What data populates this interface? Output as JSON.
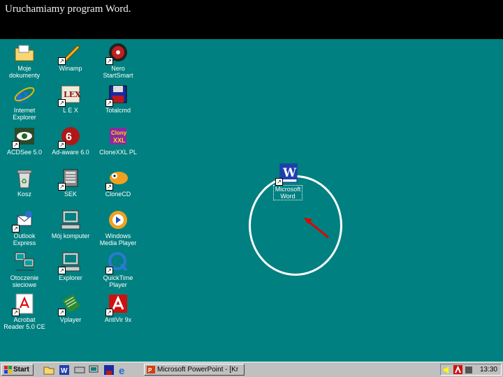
{
  "caption": "Uruchamiamy program Word.",
  "desktop_icons": [
    {
      "label": "Moje\ndokumenty",
      "icon": "folder-icon"
    },
    {
      "label": "Winamp",
      "icon": "winamp-icon"
    },
    {
      "label": "Nero\nStartSmart",
      "icon": "nero-icon"
    },
    {
      "label": "Internet\nExplorer",
      "icon": "internet-explorer-icon"
    },
    {
      "label": "L E X",
      "icon": "lex-icon"
    },
    {
      "label": "Totalcmd",
      "icon": "total-commander-icon"
    },
    {
      "label": "ACDSee 5.0",
      "icon": "acdsee-icon"
    },
    {
      "label": "Ad-aware 6.0",
      "icon": "adaware-icon"
    },
    {
      "label": "CloneXXL PL",
      "icon": "clonexxl-icon"
    },
    {
      "label": "Kosz",
      "icon": "recycle-bin-icon"
    },
    {
      "label": "SEK",
      "icon": "sek-icon"
    },
    {
      "label": "CloneCD",
      "icon": "clonecd-icon"
    },
    {
      "label": "Outlook\nExpress",
      "icon": "outlook-express-icon"
    },
    {
      "label": "Mój komputer",
      "icon": "my-computer-icon"
    },
    {
      "label": "Windows\nMedia Player",
      "icon": "media-player-icon"
    },
    {
      "label": "Otoczenie\nsieciowe",
      "icon": "network-icon"
    },
    {
      "label": "Explorer",
      "icon": "explorer-icon"
    },
    {
      "label": "QuickTime\nPlayer",
      "icon": "quicktime-icon"
    },
    {
      "label": "Acrobat\nReader 5.0 CE",
      "icon": "acrobat-icon"
    },
    {
      "label": "Vplayer",
      "icon": "vplayer-icon"
    },
    {
      "label": "AntiVir 9x",
      "icon": "antivir-icon"
    }
  ],
  "word_icon": {
    "label": "Microsoft\nWord",
    "icon": "word-icon"
  },
  "taskbar": {
    "start_label": "Start",
    "task_label": "Microsoft PowerPoint - [Kr",
    "clock": "13:30"
  },
  "colors": {
    "desktop": "#008080",
    "highlight": "#ffffff",
    "arrow": "#e00000"
  }
}
